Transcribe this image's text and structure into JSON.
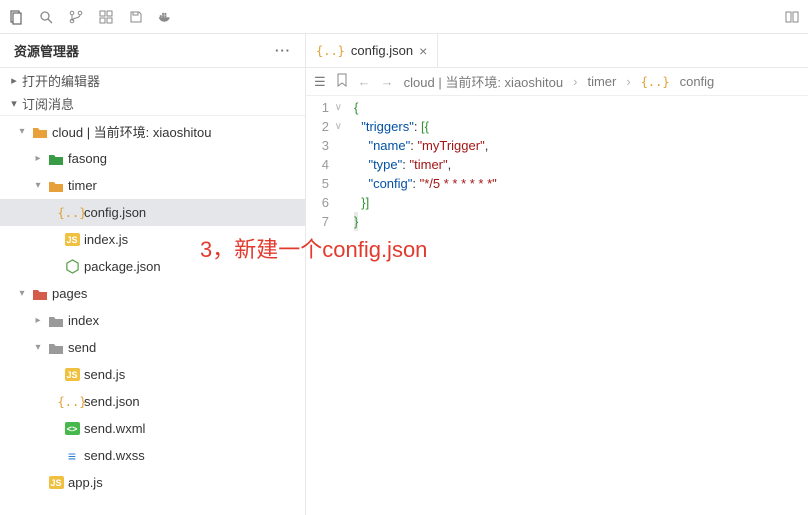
{
  "sidebar": {
    "title": "资源管理器",
    "sections": {
      "open_editors": "打开的编辑器",
      "subscribed": "订阅消息"
    },
    "tree": [
      {
        "depth": 0,
        "exp": "▾",
        "icon": "folder-y",
        "label": "cloud | 当前环境: xiaoshitou"
      },
      {
        "depth": 1,
        "exp": "▸",
        "icon": "folder-g",
        "label": "fasong"
      },
      {
        "depth": 1,
        "exp": "▾",
        "icon": "folder-y",
        "label": "timer"
      },
      {
        "depth": 2,
        "exp": "",
        "icon": "braces",
        "label": "config.json",
        "selected": true
      },
      {
        "depth": 2,
        "exp": "",
        "icon": "js",
        "label": "index.js"
      },
      {
        "depth": 2,
        "exp": "",
        "icon": "node",
        "label": "package.json"
      },
      {
        "depth": 0,
        "exp": "▾",
        "icon": "folder-r",
        "label": "pages"
      },
      {
        "depth": 1,
        "exp": "▸",
        "icon": "folder-gr",
        "label": "index"
      },
      {
        "depth": 1,
        "exp": "▾",
        "icon": "folder-gr",
        "label": "send"
      },
      {
        "depth": 2,
        "exp": "",
        "icon": "js",
        "label": "send.js"
      },
      {
        "depth": 2,
        "exp": "",
        "icon": "braces",
        "label": "send.json"
      },
      {
        "depth": 2,
        "exp": "",
        "icon": "wxml",
        "label": "send.wxml"
      },
      {
        "depth": 2,
        "exp": "",
        "icon": "wxss",
        "label": "send.wxss"
      },
      {
        "depth": 1,
        "exp": "",
        "icon": "js",
        "label": "app.js",
        "cut": true
      }
    ]
  },
  "editor": {
    "tab": {
      "icon": "braces",
      "label": "config.json"
    },
    "breadcrumbs": [
      "cloud | 当前环境: xiaoshitou",
      "timer",
      "config"
    ],
    "code_lines": [
      {
        "n": 1,
        "fold": "∨",
        "html": "<span class='t-brk'>{</span>"
      },
      {
        "n": 2,
        "fold": "∨",
        "html": "  <span class='t-key'>\"triggers\"</span><span class='t-pun'>: </span><span class='t-brk'>[{</span>"
      },
      {
        "n": 3,
        "fold": "",
        "html": "    <span class='t-key'>\"name\"</span><span class='t-pun'>: </span><span class='t-str'>\"myTrigger\"</span><span class='t-pun'>,</span>"
      },
      {
        "n": 4,
        "fold": "",
        "html": "    <span class='t-key'>\"type\"</span><span class='t-pun'>: </span><span class='t-str'>\"timer\"</span><span class='t-pun'>,</span>"
      },
      {
        "n": 5,
        "fold": "",
        "html": "    <span class='t-key'>\"config\"</span><span class='t-pun'>: </span><span class='t-str'>\"*/5 * * * * * *\"</span>"
      },
      {
        "n": 6,
        "fold": "",
        "html": "  <span class='t-brk'>}]</span>"
      },
      {
        "n": 7,
        "fold": "",
        "html": "<span class='t-brk cursorline'>}</span>"
      }
    ]
  },
  "annotation": "3，新建一个config.json"
}
